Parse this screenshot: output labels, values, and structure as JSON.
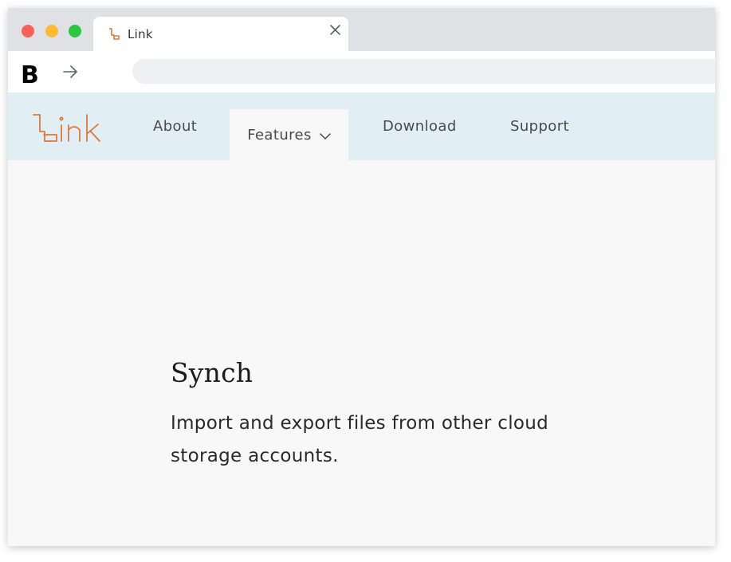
{
  "browser": {
    "tab": {
      "title": "Link",
      "favicon": "link-logo-icon",
      "close_icon": "close-icon"
    },
    "toolbar": {
      "nav_badge": "B",
      "forward_icon": "arrow-right-icon",
      "address_value": ""
    }
  },
  "site": {
    "logo_text": "Link",
    "brand_color": "#e0773a",
    "nav_background": "#e1eff4",
    "nav": [
      {
        "label": "About"
      },
      {
        "label": "Features",
        "icon": "chevron-down-icon",
        "active": true
      },
      {
        "label": "Download"
      },
      {
        "label": "Support"
      }
    ]
  },
  "content": {
    "title": "Synch",
    "body": "Import and export files from other cloud storage accounts."
  }
}
